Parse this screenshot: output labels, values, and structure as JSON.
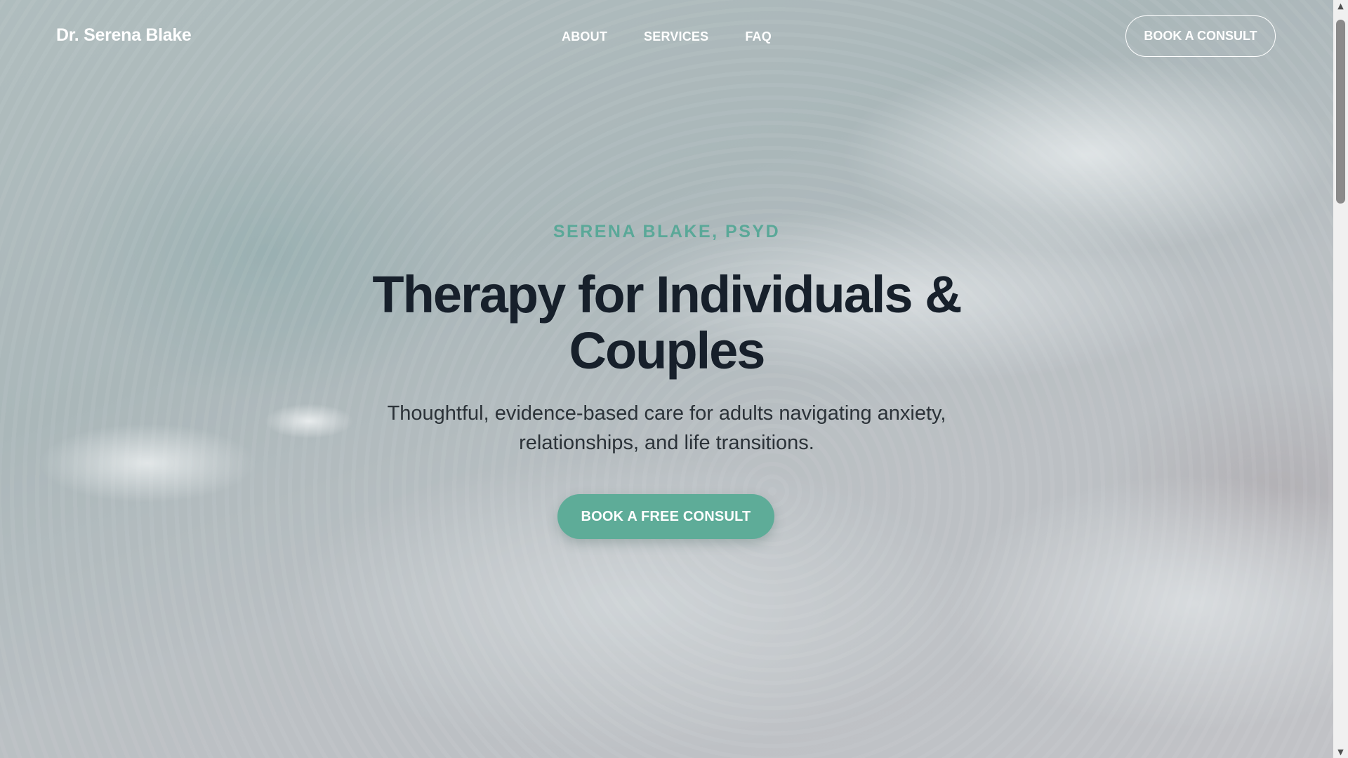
{
  "header": {
    "brand": "Dr. Serena Blake",
    "nav": [
      {
        "label": "ABOUT"
      },
      {
        "label": "SERVICES"
      },
      {
        "label": "FAQ"
      }
    ],
    "cta_label": "BOOK A CONSULT"
  },
  "hero": {
    "eyebrow": "SERENA BLAKE, PSYD",
    "title_line1": "Therapy for Individuals &",
    "title_line2": "Couples",
    "subtitle_line1": "Thoughtful, evidence-based care for adults navigating anxiety,",
    "subtitle_line2": "relationships, and life transitions.",
    "cta_label": "BOOK A FREE CONSULT",
    "background": "aerial-ocean-waves-image"
  },
  "colors": {
    "accent": "#5eac98",
    "eyebrow": "#5aa898",
    "title": "#17202b",
    "nav_text": "#ffffff"
  },
  "scrollbar": {
    "up_icon": "triangle-up",
    "down_icon": "triangle-down"
  }
}
